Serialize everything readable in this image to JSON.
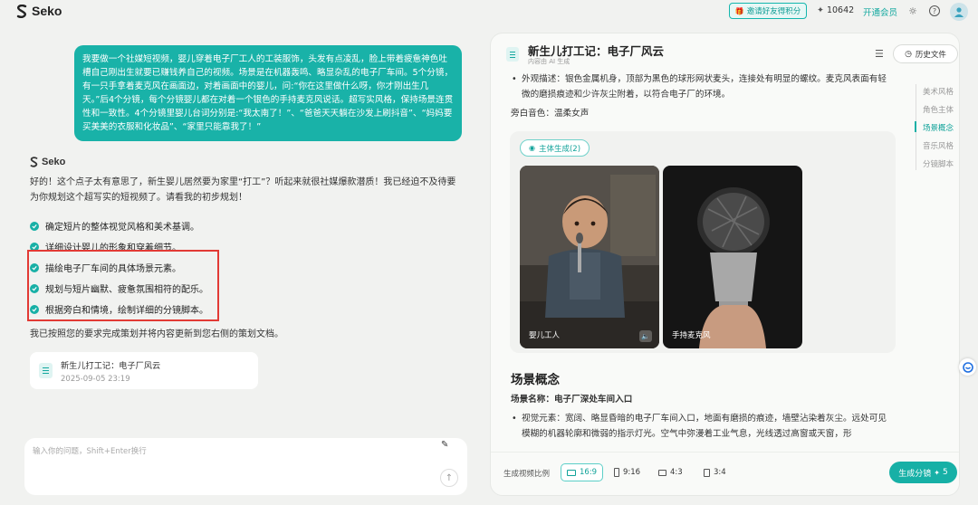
{
  "app": {
    "name": "Seko"
  },
  "topbar": {
    "invite_label": "邀请好友得积分",
    "credits": "10642",
    "member_label": "开通会员"
  },
  "chat": {
    "user_message": "我要做一个社媒短视频，婴儿穿着电子厂工人的工装服饰，头发有点凌乱，脸上带着疲惫神色吐槽自己刚出生就要已赚钱养自己的视频。场景是在机器轰鸣、略显杂乱的电子厂车间。5个分镜，有一只手拿着麦克风在画面边，对着画面中的婴儿，问:“你在这里做什么呀，你才刚出生几天。”后4个分镜，每个分镜婴儿都在对着一个银色的手持麦克风说话。超写实风格，保持场景连贯性和一致性。4个分镜里婴儿台词分别是:“我太南了！”、“爸爸天天躺在沙发上刷抖音”、“妈妈要买美美的衣服和化妆品”、“家里只能靠我了！”",
    "assistant_name": "Seko",
    "intro": "好的！这个点子太有意思了，新生婴儿居然要为家里“打工”？听起来就很社媒爆款潜质！我已经迫不及待要为你规划这个超写实的短视频了。请看我的初步规划！",
    "plan_items": [
      "确定短片的整体视觉风格和美术基调。",
      "详细设计婴儿的形象和穿着细节。",
      "描绘电子厂车间的具体场景元素。",
      "规划与短片幽默、疲惫氛围相符的配乐。",
      "根据旁白和情境，绘制详细的分镜脚本。"
    ],
    "outro": "我已按照您的要求完成策划并将内容更新到您右侧的策划文档。",
    "doc_card": {
      "title": "新生儿打工记：电子厂风云",
      "date": "2025-09-05 23:19"
    },
    "input_placeholder": "输入你的问题，Shift+Enter换行"
  },
  "doc": {
    "title": "新生儿打工记：电子厂风云",
    "subtitle": "内容由 AI 生成",
    "history_label": "历史文件",
    "toc": [
      "美术风格",
      "角色主体",
      "场景概念",
      "音乐风格",
      "分镜脚本"
    ],
    "toc_active": 2,
    "appearance_text": "外观描述：银色金属机身，顶部为黑色的球形网状麦头，连接处有明显的螺纹。麦克风表面有轻微的磨损痕迹和少许灰尘附着，以符合电子厂的环境。",
    "voice_line": "旁白音色：温柔女声",
    "subject_chip": "主体生成(2)",
    "images": [
      {
        "label": "婴儿工人"
      },
      {
        "label": "手持麦克风"
      }
    ],
    "scene_heading": "场景概念",
    "scene_name": "场景名称：电子厂深处车间入口",
    "scene_visual": "视觉元素：宽阔、略显昏暗的电子厂车间入口，地面有磨损的痕迹，墙壁沾染着灰尘。远处可见模糊的机器轮廓和微弱的指示灯光。空气中弥漫着工业气息，光线透过高窗或天窗，形"
  },
  "footer": {
    "ratio_label": "生成视频比例",
    "ratios": [
      "16:9",
      "9:16",
      "4:3",
      "3:4"
    ],
    "active_ratio": "16:9",
    "generate_label": "生成分镜",
    "generate_cost": "5"
  },
  "colors": {
    "accent": "#17b0a6",
    "highlight_border": "#e23a35"
  }
}
